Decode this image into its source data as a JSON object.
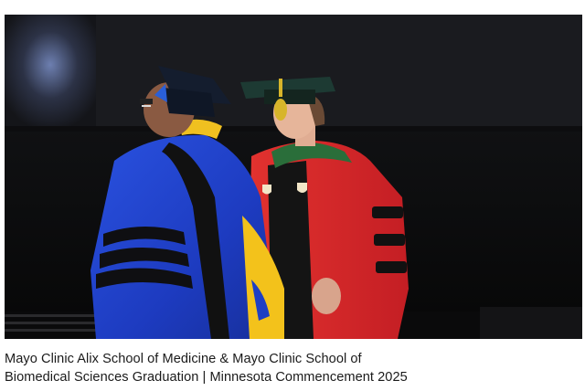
{
  "video": {
    "scene": "commencement-stage",
    "colors": {
      "background": "#0b0b0b",
      "screen": "#1b1d22",
      "gown_blue": "#1e3fc4",
      "velvet_black": "#111111",
      "gold_hood": "#f3c21b",
      "gown_red": "#d9262a",
      "hood_green": "#2a6e3a",
      "tassel_gold": "#d7b52a"
    }
  },
  "caption": {
    "line1": "Mayo Clinic Alix School of Medicine & Mayo Clinic School of",
    "line2": "Biomedical Sciences Graduation | Minnesota Commencement 2025"
  }
}
